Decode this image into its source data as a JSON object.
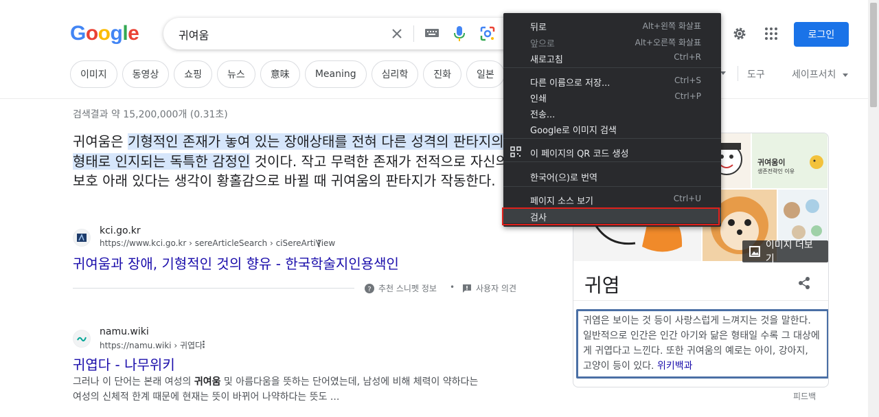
{
  "header": {
    "search_query": "귀여움",
    "login_label": "로그인"
  },
  "chips": [
    "이미지",
    "동영상",
    "쇼핑",
    "뉴스",
    "意味",
    "Meaning",
    "심리학",
    "진화",
    "일본"
  ],
  "toolbar": {
    "tools": "도구",
    "safe_search": "세이프서치"
  },
  "results": {
    "stats": "검색결과 약 15,200,000개 (0.31초)",
    "snippet": {
      "before": "귀여움은 ",
      "highlight1": "기형적인 존재가 놓여 있는 장애상태를 전혀 다른 성격의 판타지",
      "line2_highlight": "의 형태로 인지되는 독특한 감정인",
      "after": " 것이다. 작고 무력한 존재가 전적으로 자신의 보호 아래 있다는 생각이 황홀감으로 바뀔 때 귀여움의 판타지가 작동한다."
    },
    "item1": {
      "site_name": "kci.go.kr",
      "site_url": "https://www.kci.go.kr › sereArticleSearch › ciSereArtiView",
      "title": "귀여움과 장애, 기형적인 것의 향유 - 한국학술지인용색인"
    },
    "feedback": {
      "about": "추천 스니펫 정보",
      "dot": "•",
      "opinion": "사용자 의견"
    },
    "item2": {
      "site_name": "namu.wiki",
      "site_url": "https://namu.wiki › 귀엽다",
      "title": "귀엽다 - 나무위키",
      "desc_before": "그러나 이 단어는 본래 여성의 ",
      "desc_bold": "귀여움",
      "desc_after": " 및 아름다움을 뜻하는 단어였는데, 남성에 비해 체력이 약하다는 여성의 신체적 한계 때문에 현재는 뜻이 바뀌어 나약하다는 뜻도 ..."
    }
  },
  "knowledge_panel": {
    "more_images": "이미지 더보기",
    "title": "귀염",
    "description": "귀염은 보이는 것 등이 사랑스럽게 느껴지는 것을 말한다. 일반적으로 인간은 인간 아기와 닮은 형태일 수록 그 대상에게 귀엽다고 느낀다. 또한 귀여움의 예로는 아이, 강아지, 고양이 등이 있다.",
    "source": "위키백과",
    "image_text_1": "귀여움이",
    "image_text_2": "생존전략인 이유",
    "feedback": "피드백"
  },
  "context_menu": {
    "items": [
      {
        "label": "뒤로",
        "shortcut": "Alt+왼쪽 화살표"
      },
      {
        "label": "앞으로",
        "shortcut": "Alt+오른쪽 화살표"
      },
      {
        "label": "새로고침",
        "shortcut": "Ctrl+R"
      },
      {
        "label": "다른 이름으로 저장...",
        "shortcut": "Ctrl+S"
      },
      {
        "label": "인쇄",
        "shortcut": "Ctrl+P"
      },
      {
        "label": "전송...",
        "shortcut": ""
      },
      {
        "label": "Google로 이미지 검색",
        "shortcut": ""
      },
      {
        "label": "이 페이지의 QR 코드 생성",
        "shortcut": ""
      },
      {
        "label": "한국어(으)로 번역",
        "shortcut": ""
      },
      {
        "label": "페이지 소스 보기",
        "shortcut": "Ctrl+U"
      },
      {
        "label": "검사",
        "shortcut": ""
      }
    ]
  },
  "colors": {
    "link": "#1a0dab",
    "login_bg": "#1a73e8",
    "menu_bg": "#292a2d",
    "highlight_box": "#e0201b"
  }
}
